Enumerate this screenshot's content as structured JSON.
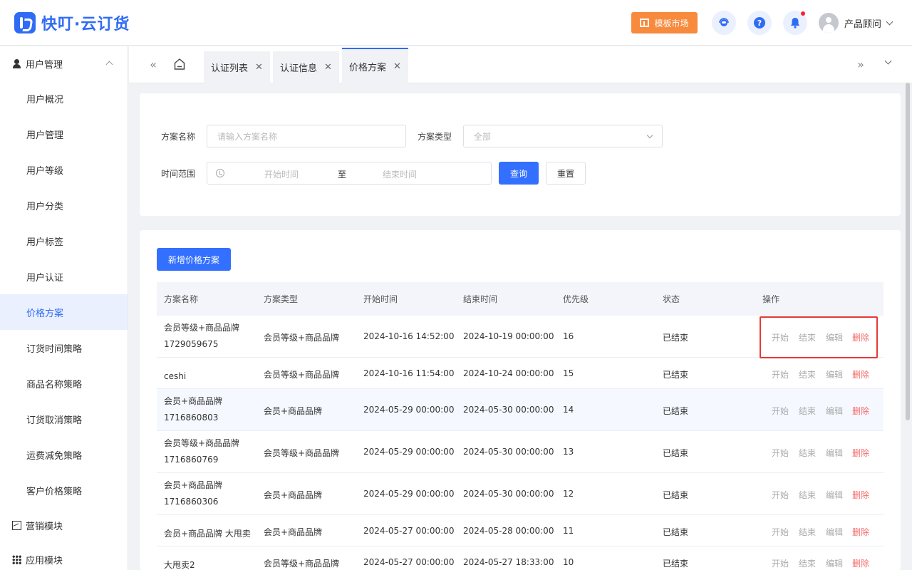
{
  "app": {
    "logo_text": "快叮·云订货"
  },
  "header": {
    "market_label": "模板市场",
    "user_name": "产品顾问"
  },
  "sidebar": {
    "group_user": "用户管理",
    "items": [
      "用户概况",
      "用户管理",
      "用户等级",
      "用户分类",
      "用户标签",
      "用户认证",
      "价格方案",
      "订货时间策略",
      "商品名称策略",
      "订货取消策略",
      "运费减免策略",
      "客户价格策略"
    ],
    "active_index": 6,
    "group_marketing": "营销模块",
    "group_apps": "应用模块"
  },
  "tabs": [
    {
      "label": "认证列表"
    },
    {
      "label": "认证信息"
    },
    {
      "label": "价格方案"
    }
  ],
  "filter": {
    "name_label": "方案名称",
    "name_placeholder": "请输入方案名称",
    "type_label": "方案类型",
    "type_value": "全部",
    "time_label": "时间范围",
    "start_placeholder": "开始时间",
    "range_sep": "至",
    "end_placeholder": "结束时间",
    "query_btn": "查询",
    "reset_btn": "重置"
  },
  "add_button": "新增价格方案",
  "table": {
    "headers": [
      "方案名称",
      "方案类型",
      "开始时间",
      "结束时间",
      "优先级",
      "状态",
      "操作"
    ],
    "actions": [
      "开始",
      "结束",
      "编辑",
      "删除"
    ],
    "rows": [
      {
        "name": "会员等级+商品品牌1729059675",
        "type": "会员等级+商品品牌",
        "start": "2024-10-16 14:52:00",
        "end": "2024-10-19 00:00:00",
        "priority": "16",
        "status": "已结束"
      },
      {
        "name": "ceshi",
        "type": "会员等级+商品品牌",
        "start": "2024-10-16 11:54:00",
        "end": "2024-10-24 00:00:00",
        "priority": "15",
        "status": "已结束"
      },
      {
        "name": "会员+商品品牌1716860803",
        "type": "会员+商品品牌",
        "start": "2024-05-29 00:00:00",
        "end": "2024-05-30 00:00:00",
        "priority": "14",
        "status": "已结束"
      },
      {
        "name": "会员等级+商品品牌1716860769",
        "type": "会员等级+商品品牌",
        "start": "2024-05-29 00:00:00",
        "end": "2024-05-30 00:00:00",
        "priority": "13",
        "status": "已结束"
      },
      {
        "name": "会员+商品品牌1716860306",
        "type": "会员+商品品牌",
        "start": "2024-05-29 00:00:00",
        "end": "2024-05-30 00:00:00",
        "priority": "12",
        "status": "已结束"
      },
      {
        "name": "会员+商品品牌 大甩卖",
        "type": "会员+商品品牌",
        "start": "2024-05-27 00:00:00",
        "end": "2024-05-28 00:00:00",
        "priority": "11",
        "status": "已结束"
      },
      {
        "name": "大甩卖2",
        "type": "会员等级+商品品牌",
        "start": "2024-05-27 00:00:00",
        "end": "2024-05-27 18:33:00",
        "priority": "10",
        "status": "已结束"
      }
    ]
  }
}
